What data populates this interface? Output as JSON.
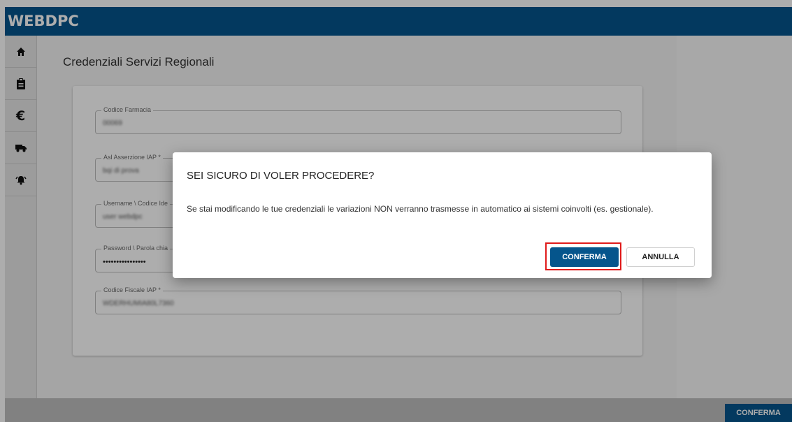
{
  "app": {
    "logo": "WEBDPC"
  },
  "sidebar": {
    "items": [
      {
        "icon": "home-icon"
      },
      {
        "icon": "clipboard-icon"
      },
      {
        "icon": "euro-icon"
      },
      {
        "icon": "truck-icon"
      },
      {
        "icon": "bell-alert-icon"
      }
    ]
  },
  "page": {
    "title": "Credenziali Servizi Regionali",
    "fields": [
      {
        "label": "Codice Farmacia",
        "value": "00069"
      },
      {
        "label": "Asl Asserzione IAP *",
        "value": "bqi di prova"
      },
      {
        "label": "Username \\ Codice Ide",
        "value": "user webdpc"
      },
      {
        "label": "Password \\ Parola chia",
        "value": "••••••••••••••••"
      },
      {
        "label": "Codice Fiscale IAP *",
        "value": "WDERHUMIA80L7360"
      }
    ]
  },
  "footer": {
    "confirm_label": "CONFERMA"
  },
  "dialog": {
    "title": "SEI SICURO DI VOLER PROCEDERE?",
    "message": "Se stai modificando le tue credenziali le variazioni NON verranno trasmesse in automatico ai sistemi coinvolti (es. gestionale).",
    "confirm_label": "CONFERMA",
    "cancel_label": "ANNULLA"
  },
  "colors": {
    "brand": "#05558c",
    "highlight": "#e01a1a"
  }
}
